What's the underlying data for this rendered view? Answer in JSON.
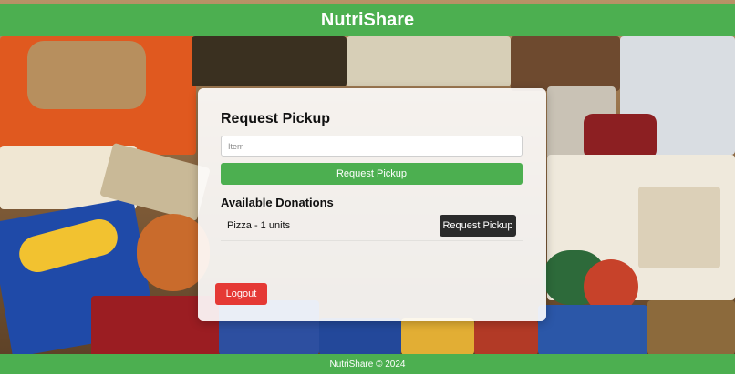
{
  "header": {
    "brand": "NutriShare"
  },
  "request_card": {
    "title": "Request Pickup",
    "item_placeholder": "Item",
    "item_value": "",
    "submit_label": "Request Pickup"
  },
  "donations": {
    "title": "Available Donations",
    "items": [
      {
        "label": "Pizza - 1 units",
        "action_label": "Request Pickup"
      }
    ]
  },
  "logout_label": "Logout",
  "footer": {
    "text": "NutriShare © 2024"
  },
  "colors": {
    "brand_green": "#4caf50",
    "logout_red": "#e53935",
    "dark_button": "#2b2b2b"
  }
}
